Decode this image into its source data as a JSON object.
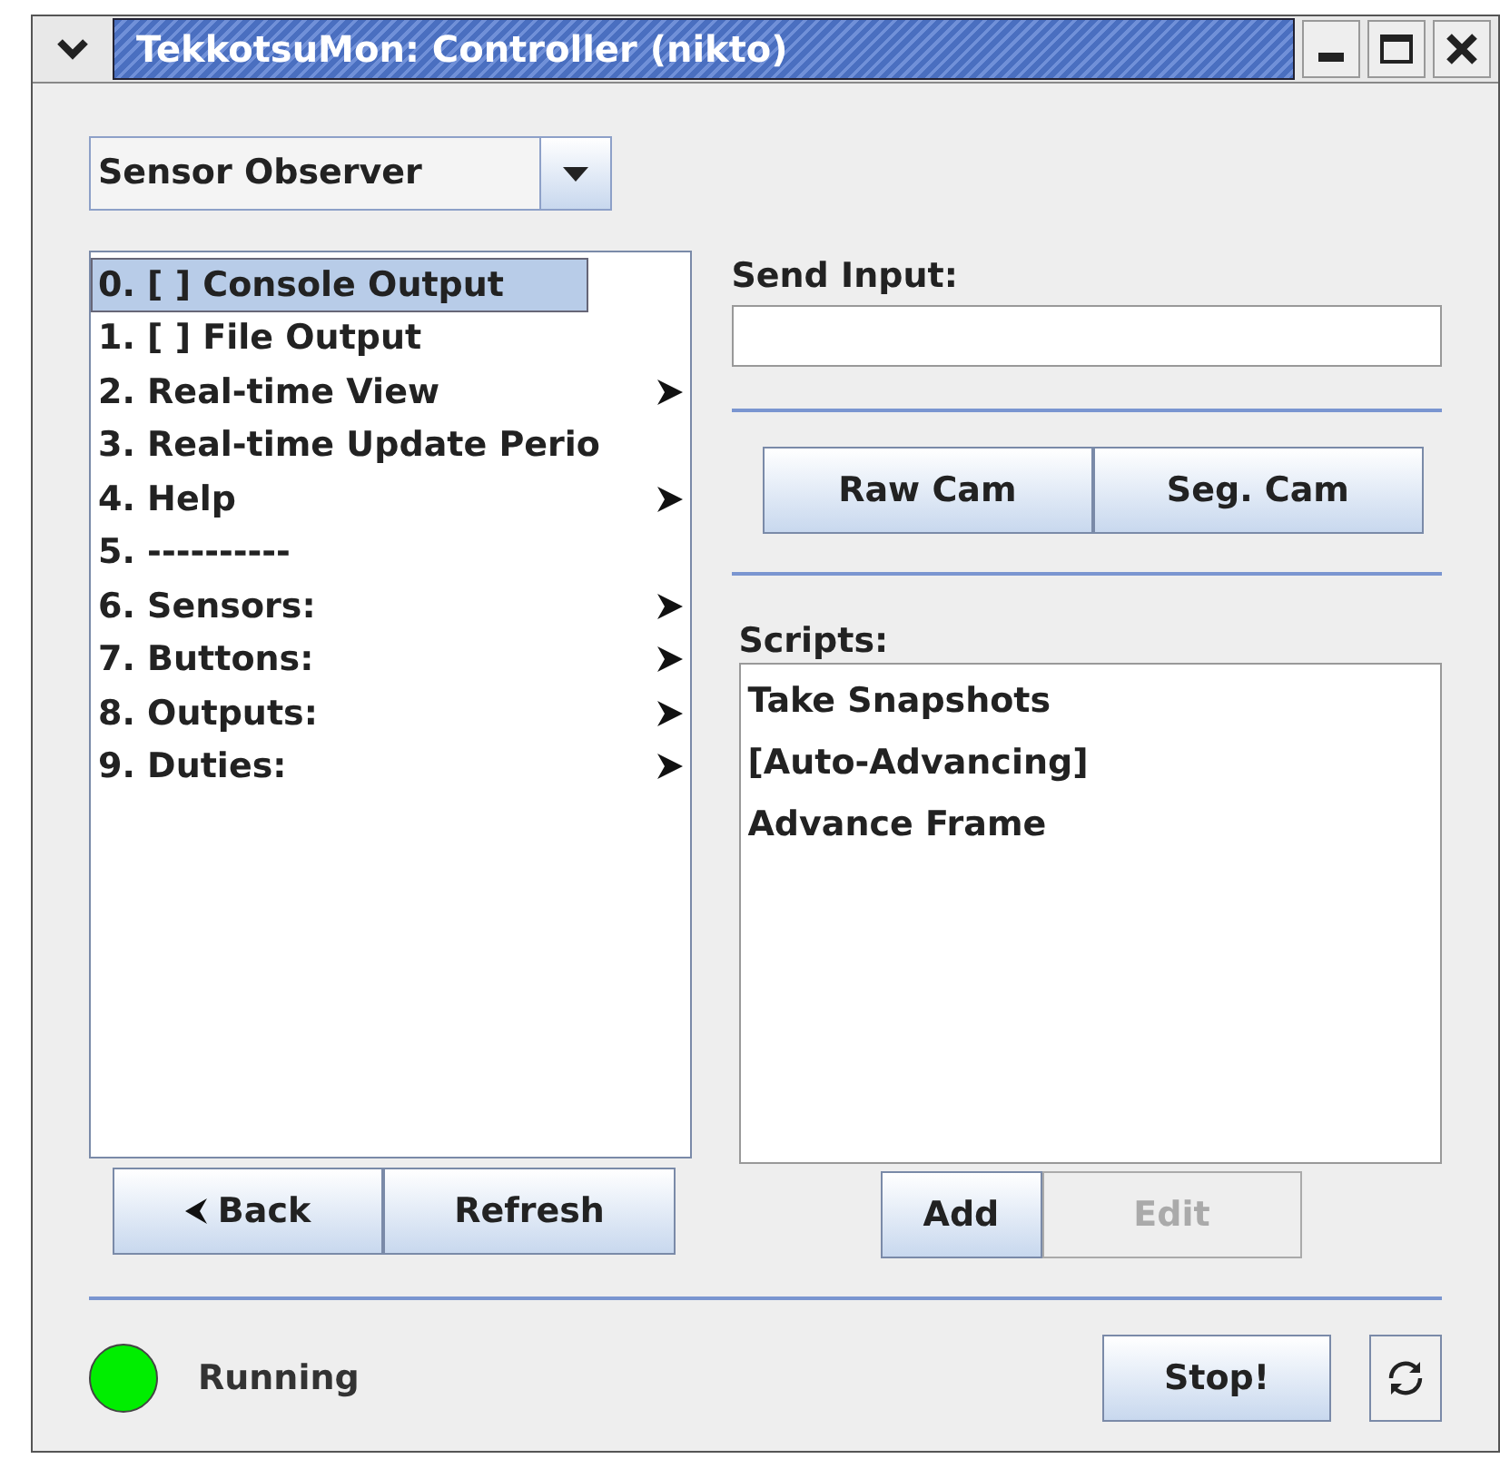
{
  "window": {
    "title": "TekkotsuMon: Controller (nikto)"
  },
  "mode_dropdown": {
    "value": "Sensor Observer"
  },
  "menu_items": [
    {
      "label": "0. [ ] Console Output",
      "selected": true,
      "submenu": false
    },
    {
      "label": "1. [ ] File Output",
      "selected": false,
      "submenu": false
    },
    {
      "label": "2. Real-time View",
      "selected": false,
      "submenu": true
    },
    {
      "label": "3. Real-time Update Perio",
      "selected": false,
      "submenu": false
    },
    {
      "label": "4. Help",
      "selected": false,
      "submenu": true
    },
    {
      "label": "5. ----------",
      "selected": false,
      "submenu": false
    },
    {
      "label": "6. Sensors:",
      "selected": false,
      "submenu": true
    },
    {
      "label": "7. Buttons:",
      "selected": false,
      "submenu": true
    },
    {
      "label": "8. Outputs:",
      "selected": false,
      "submenu": true
    },
    {
      "label": "9. Duties:",
      "selected": false,
      "submenu": true
    }
  ],
  "nav_buttons": [
    {
      "label": "Back",
      "kind": "back",
      "disabled": false
    },
    {
      "label": "Refresh",
      "kind": "plain",
      "disabled": false
    }
  ],
  "send_input": {
    "label": "Send Input:"
  },
  "cam_buttons": [
    {
      "label": "Raw Cam"
    },
    {
      "label": "Seg. Cam"
    }
  ],
  "scripts": {
    "label": "Scripts:",
    "items": [
      {
        "label": "Take Snapshots"
      },
      {
        "label": "[Auto-Advancing]"
      },
      {
        "label": "Advance Frame"
      }
    ],
    "buttons": [
      {
        "label": "Add",
        "disabled": false
      },
      {
        "label": "Edit",
        "disabled": true
      }
    ]
  },
  "status": {
    "text": "Running",
    "color": "#00ee00"
  },
  "stop_button": {
    "label": "Stop!"
  }
}
